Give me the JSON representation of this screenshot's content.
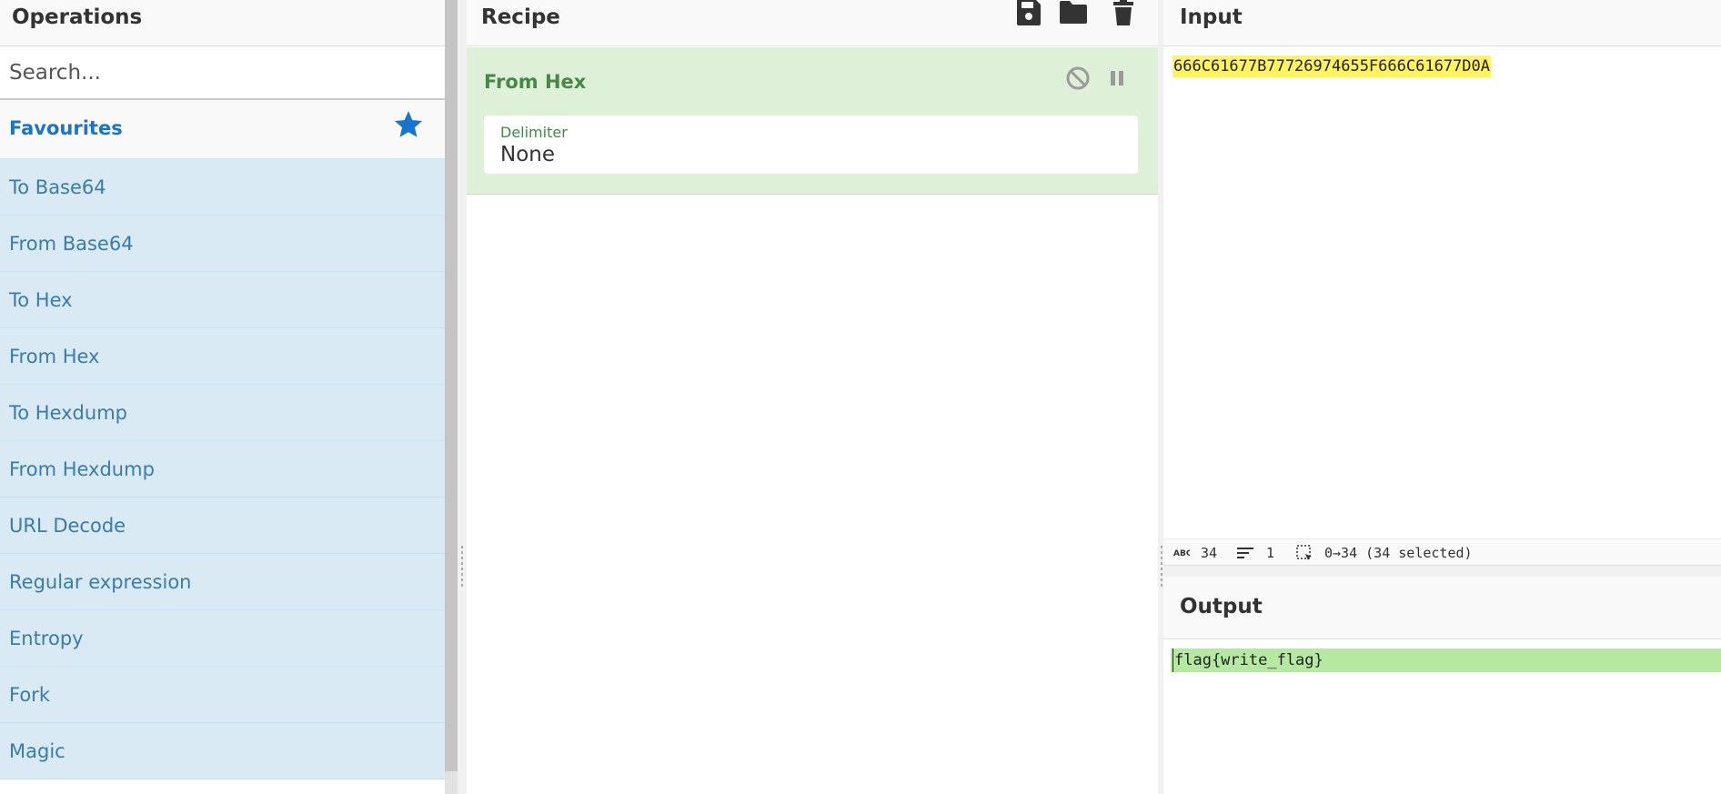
{
  "operations": {
    "title": "Operations",
    "search_placeholder": "Search...",
    "favourites_label": "Favourites",
    "items": [
      {
        "label": "To Base64"
      },
      {
        "label": "From Base64"
      },
      {
        "label": "To Hex"
      },
      {
        "label": "From Hex"
      },
      {
        "label": "To Hexdump"
      },
      {
        "label": "From Hexdump"
      },
      {
        "label": "URL Decode"
      },
      {
        "label": "Regular expression"
      },
      {
        "label": "Entropy"
      },
      {
        "label": "Fork"
      },
      {
        "label": "Magic"
      }
    ]
  },
  "recipe": {
    "title": "Recipe",
    "operation": {
      "title": "From Hex",
      "delimiter_label": "Delimiter",
      "delimiter_value": "None"
    }
  },
  "input": {
    "title": "Input",
    "text": "666C61677B77726974655F666C61677D0A",
    "status": {
      "length": "34",
      "lines": "1",
      "selection": "0→34 (34 selected)"
    }
  },
  "output": {
    "title": "Output",
    "text": "flag{write_flag}"
  },
  "colors": {
    "accent_blue": "#1874cd",
    "op_item_bg": "#d9eaf5",
    "op_item_text": "#3a7ba8",
    "recipe_op_bg": "#dff0d8",
    "recipe_op_text": "#468847",
    "input_highlight": "#fff45d",
    "output_highlight": "#b5e8a0"
  },
  "icons": [
    "star-icon",
    "save-icon",
    "folder-icon",
    "trash-icon",
    "disable-icon",
    "pause-icon",
    "abc-icon",
    "lines-icon",
    "selection-icon"
  ]
}
